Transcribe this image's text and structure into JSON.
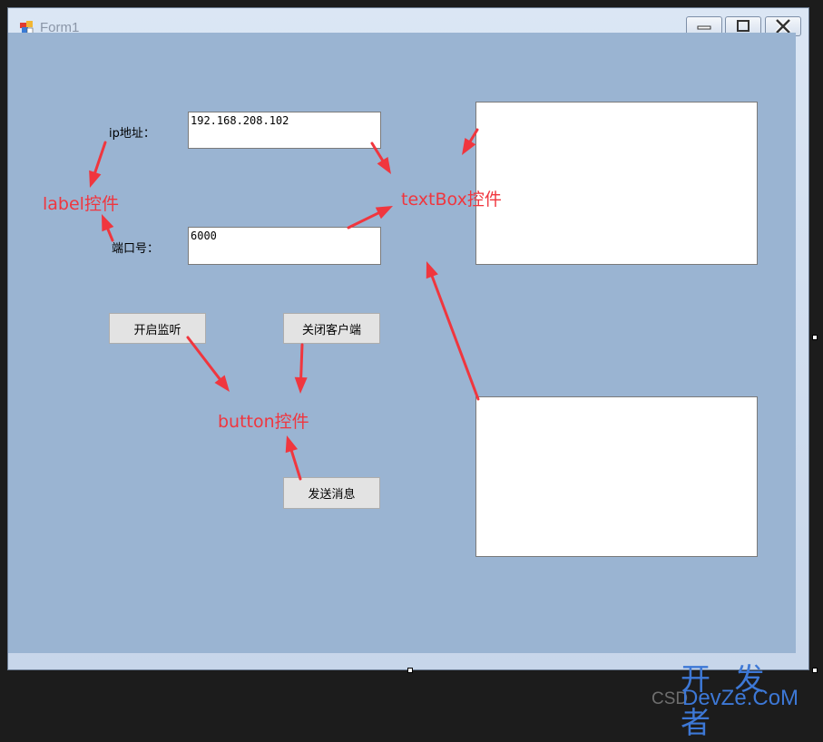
{
  "window": {
    "title": "Form1"
  },
  "labels": {
    "ip": "ip地址：",
    "port": "端口号："
  },
  "inputs": {
    "ip_value": "192.168.208.102",
    "port_value": "6000"
  },
  "buttons": {
    "start_listen": "开启监听",
    "close_client": "关闭客户端",
    "send_message": "发送消息"
  },
  "annotations": {
    "label": "label控件",
    "textbox": "textBox控件",
    "button": "button控件"
  },
  "watermark": {
    "site_cn": "开 发 者",
    "csdn": "CSD",
    "site": "DevZe.CoM"
  },
  "colors": {
    "annotation": "#f0363e",
    "client_bg": "#9ab4d2",
    "watermark": "#3d78d6"
  }
}
